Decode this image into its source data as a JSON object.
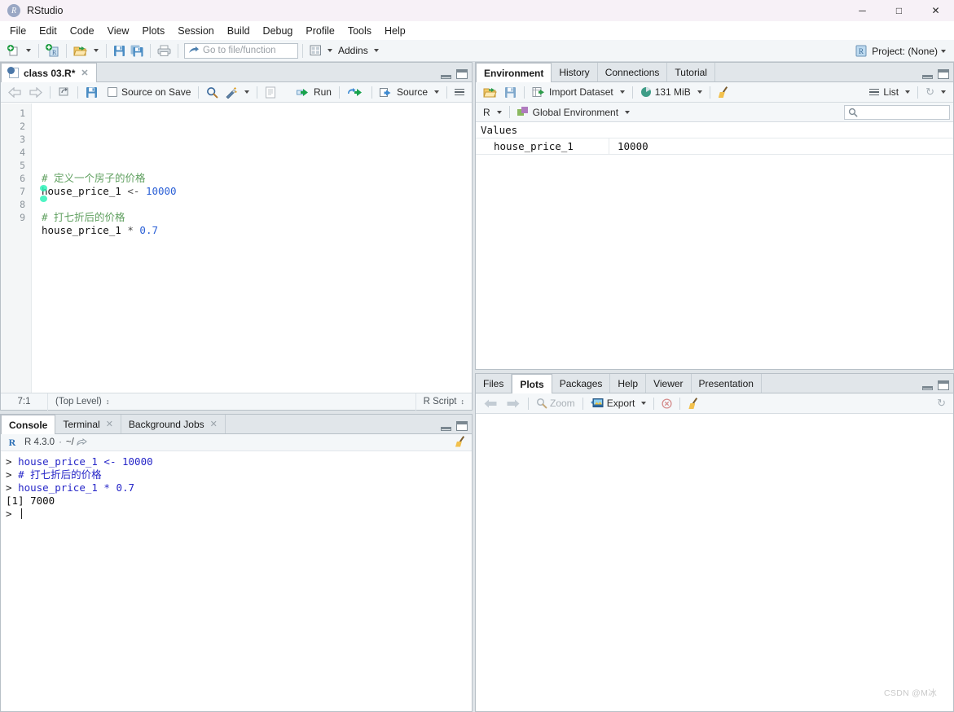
{
  "window": {
    "title": "RStudio",
    "app_icon": "rstudio-icon",
    "controls": {
      "minimize": "─",
      "maximize": "□",
      "close": "✕"
    }
  },
  "menubar": {
    "items": [
      "File",
      "Edit",
      "Code",
      "View",
      "Plots",
      "Session",
      "Build",
      "Debug",
      "Profile",
      "Tools",
      "Help"
    ]
  },
  "toolbar": {
    "new_file": "new-file-icon",
    "new_project": "new-project-icon",
    "open_file": "open-folder-icon",
    "save": "save-icon",
    "save_all": "save-all-icon",
    "print": "print-icon",
    "goto_placeholder": "Go to file/function",
    "panes_icon": "workspace-panes-icon",
    "addins_label": "Addins",
    "project_label": "Project: (None)"
  },
  "source_pane": {
    "tab": {
      "label": "class 03.R*",
      "close": "✕"
    },
    "toolbar": {
      "back": "back-arrow-icon",
      "forward": "forward-arrow-icon",
      "popout": "show-in-new-window-icon",
      "save": "save-icon",
      "source_on_save_label": "Source on Save",
      "find": "find-icon",
      "magic": "code-tools-icon",
      "compile_report": "compile-report-icon",
      "run_label": "Run",
      "rerun": "re-run-icon",
      "source_label": "Source",
      "outline": "document-outline-icon"
    },
    "gutter": [
      "1",
      "2",
      "3",
      "4",
      "5",
      "6",
      "7",
      "8",
      "9"
    ],
    "code_lines": [
      {
        "num": 1,
        "tokens": []
      },
      {
        "num": 2,
        "tokens": [
          {
            "t": "comment",
            "s": "# 定义一个房子的价格"
          }
        ]
      },
      {
        "num": 3,
        "tokens": [
          {
            "t": "id",
            "s": "house_price_1 "
          },
          {
            "t": "op",
            "s": "<- "
          },
          {
            "t": "num",
            "s": "10000"
          }
        ]
      },
      {
        "num": 4,
        "tokens": []
      },
      {
        "num": 5,
        "tokens": [
          {
            "t": "comment",
            "s": "# 打七折后的价格"
          }
        ]
      },
      {
        "num": 6,
        "tokens": [
          {
            "t": "id",
            "s": "house_price_1 "
          },
          {
            "t": "op",
            "s": "* "
          },
          {
            "t": "num",
            "s": "0.7"
          }
        ]
      },
      {
        "num": 7,
        "tokens": []
      },
      {
        "num": 8,
        "tokens": []
      },
      {
        "num": 9,
        "tokens": []
      }
    ],
    "status": {
      "cursor_position": "7:1",
      "scope": "(Top Level)",
      "file_type": "R Script"
    }
  },
  "console_pane": {
    "tabs": [
      {
        "label": "Console",
        "active": true,
        "closeable": false
      },
      {
        "label": "Terminal",
        "active": false,
        "closeable": true
      },
      {
        "label": "Background Jobs",
        "active": false,
        "closeable": true
      }
    ],
    "header": {
      "r_icon": "r-logo-icon",
      "version": "R 4.3.0",
      "separator": "·",
      "working_dir": "~/",
      "popout": "popout-icon",
      "clear": "broom-icon"
    },
    "lines": [
      {
        "type": "input",
        "prompt": "> ",
        "text": "house_price_1 <- 10000"
      },
      {
        "type": "input",
        "prompt": "> ",
        "text": "# 打七折后的价格"
      },
      {
        "type": "input",
        "prompt": "> ",
        "text": "house_price_1 * 0.7"
      },
      {
        "type": "output",
        "prompt": "",
        "text": "[1] 7000"
      },
      {
        "type": "prompt",
        "prompt": "> ",
        "text": ""
      }
    ]
  },
  "environment_pane": {
    "tabs": [
      {
        "label": "Environment",
        "active": true
      },
      {
        "label": "History",
        "active": false
      },
      {
        "label": "Connections",
        "active": false
      },
      {
        "label": "Tutorial",
        "active": false
      }
    ],
    "toolbar": {
      "load": "open-folder-icon",
      "save": "save-icon",
      "import_dataset_label": "Import Dataset",
      "memory_label": "131 MiB",
      "memory_icon": "memory-pie-icon",
      "clear": "broom-icon",
      "view_mode_label": "List",
      "view_mode_icon": "list-icon",
      "refresh": "refresh-icon"
    },
    "scope_bar": {
      "language_label": "R",
      "environment_label": "Global Environment",
      "globe_icon": "environment-icon",
      "search_icon": "search-icon",
      "search_value": "",
      "search_placeholder": ""
    },
    "section_label": "Values",
    "variables": [
      {
        "name": "house_price_1",
        "value": "10000"
      }
    ]
  },
  "plots_pane": {
    "tabs": [
      {
        "label": "Files",
        "active": false
      },
      {
        "label": "Plots",
        "active": true
      },
      {
        "label": "Packages",
        "active": false
      },
      {
        "label": "Help",
        "active": false
      },
      {
        "label": "Viewer",
        "active": false
      },
      {
        "label": "Presentation",
        "active": false
      }
    ],
    "toolbar": {
      "back": "back-arrow-icon",
      "forward": "forward-arrow-icon",
      "zoom_label": "Zoom",
      "zoom_icon": "zoom-icon",
      "export_label": "Export",
      "export_icon": "export-icon",
      "remove_icon": "remove-plot-icon",
      "clear_icon": "broom-icon",
      "refresh_icon": "refresh-icon"
    },
    "content": ""
  },
  "watermark": "CSDN @M冰"
}
